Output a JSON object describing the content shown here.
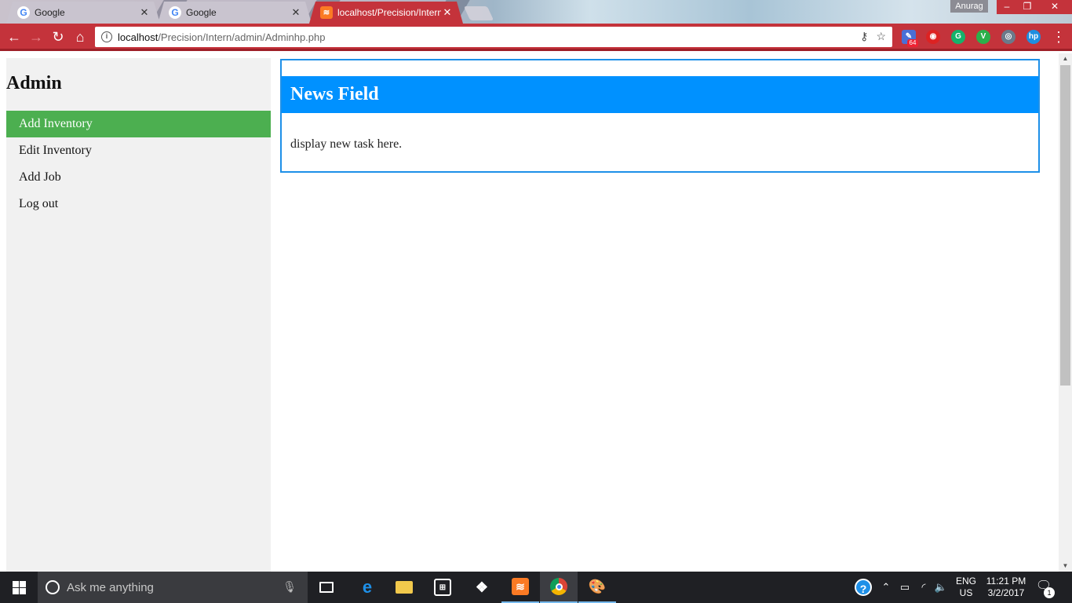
{
  "browser": {
    "tabs": [
      {
        "title": "Google",
        "favicon": "G",
        "active": false
      },
      {
        "title": "Google",
        "favicon": "G",
        "active": false
      },
      {
        "title": "localhost/Precision/Intern",
        "favicon": "≋",
        "active": true
      }
    ],
    "profile_name": "Anurag",
    "window_controls": {
      "minimize": "–",
      "maximize": "❐",
      "close": "✕"
    },
    "address": {
      "host": "localhost",
      "path": "/Precision/Intern/admin/Adminhp.php"
    },
    "extension_badge": "64",
    "colors": {
      "frame": "#c4333b",
      "frame_dark": "#9e1f27"
    }
  },
  "page": {
    "sidebar": {
      "title": "Admin",
      "items": [
        {
          "label": "Add Inventory",
          "active": true
        },
        {
          "label": "Edit Inventory",
          "active": false
        },
        {
          "label": "Add Job",
          "active": false
        },
        {
          "label": "Log out",
          "active": false
        }
      ]
    },
    "news": {
      "title": "News Field",
      "body": "display new task here."
    },
    "colors": {
      "active_nav": "#4caf50",
      "news_header": "#0091ff",
      "news_border": "#1e90e8",
      "sidebar_bg": "#f1f1f1"
    }
  },
  "taskbar": {
    "search_placeholder": "Ask me anything",
    "apps": [
      "task-view",
      "edge",
      "file-explorer",
      "store",
      "dropbox",
      "xampp",
      "chrome",
      "paint"
    ],
    "language": {
      "line1": "ENG",
      "line2": "US"
    },
    "clock": {
      "time": "11:21 PM",
      "date": "3/2/2017"
    },
    "notification_count": "1"
  }
}
